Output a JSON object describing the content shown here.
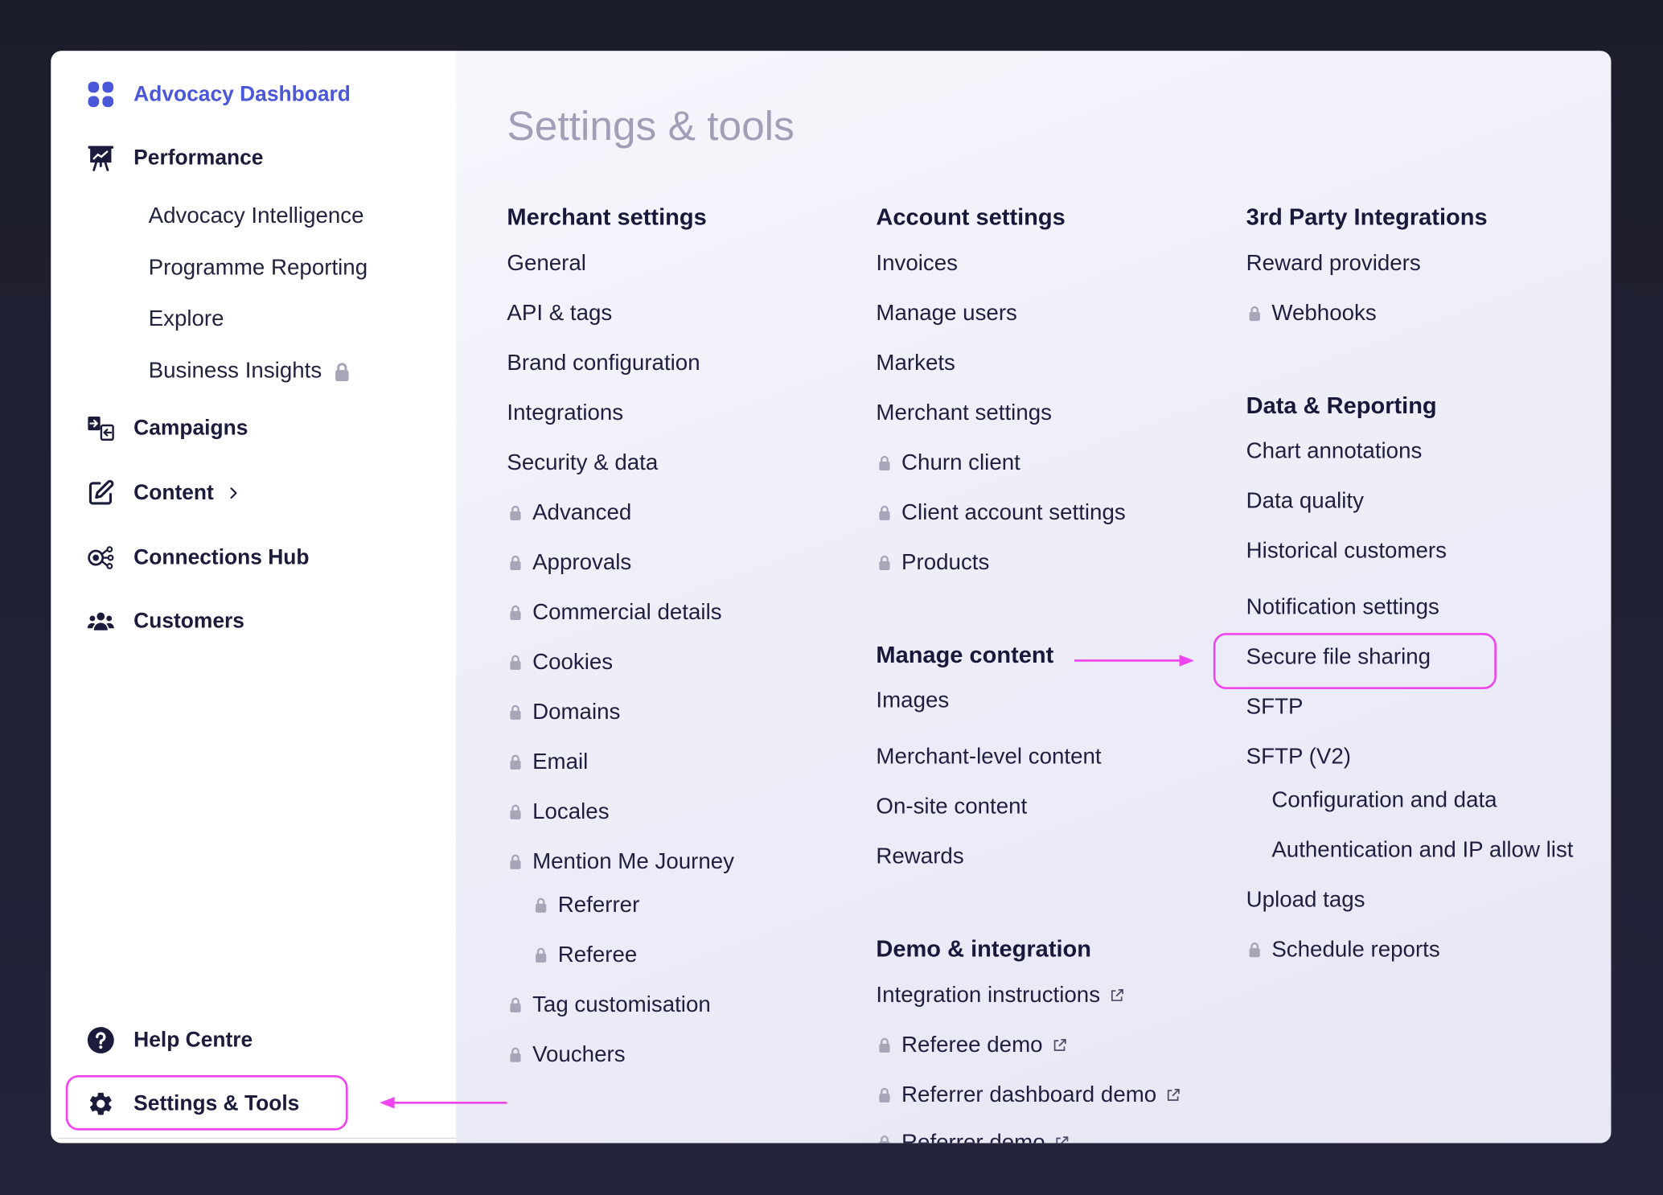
{
  "colors": {
    "page_background": "#1e1f2f",
    "accent": "#4b57d9",
    "text": "#1c1d3c",
    "title": "#9f9fb7",
    "lock": "#a6a6b8",
    "annotation": "#ee45ee"
  },
  "sidebar": {
    "dashboard": {
      "label": "Advocacy Dashboard",
      "icon": "dashboard-grid-icon",
      "active": true
    },
    "performance": {
      "label": "Performance",
      "icon": "presentation-chart-icon",
      "children": [
        {
          "label": "Advocacy Intelligence"
        },
        {
          "label": "Programme Reporting"
        },
        {
          "label": "Explore"
        },
        {
          "label": "Business Insights",
          "locked": true
        }
      ]
    },
    "campaigns": {
      "label": "Campaigns",
      "icon": "campaigns-swap-icon"
    },
    "content": {
      "label": "Content",
      "icon": "edit-icon",
      "expandable": true
    },
    "connections_hub": {
      "label": "Connections Hub",
      "icon": "connections-hub-icon"
    },
    "customers": {
      "label": "Customers",
      "icon": "users-group-icon"
    },
    "help_centre": {
      "label": "Help Centre",
      "icon": "help-circle-icon"
    },
    "settings_tools": {
      "label": "Settings & Tools",
      "icon": "gear-icon",
      "highlighted": true
    }
  },
  "main": {
    "title": "Settings & tools",
    "merchant_settings": {
      "heading": "Merchant settings",
      "items": [
        {
          "label": "General"
        },
        {
          "label": "API & tags"
        },
        {
          "label": "Brand configuration"
        },
        {
          "label": "Integrations"
        },
        {
          "label": "Security & data"
        },
        {
          "label": "Advanced",
          "locked": true
        },
        {
          "label": "Approvals",
          "locked": true
        },
        {
          "label": "Commercial details",
          "locked": true
        },
        {
          "label": "Cookies",
          "locked": true
        },
        {
          "label": "Domains",
          "locked": true
        },
        {
          "label": "Email",
          "locked": true
        },
        {
          "label": "Locales",
          "locked": true
        },
        {
          "label": "Mention Me Journey",
          "locked": true,
          "children": [
            {
              "label": "Referrer",
              "locked": true
            },
            {
              "label": "Referee",
              "locked": true
            }
          ]
        },
        {
          "label": "Tag customisation",
          "locked": true
        },
        {
          "label": "Vouchers",
          "locked": true
        }
      ]
    },
    "account_settings": {
      "heading": "Account settings",
      "items": [
        {
          "label": "Invoices"
        },
        {
          "label": "Manage users"
        },
        {
          "label": "Markets"
        },
        {
          "label": "Merchant settings"
        },
        {
          "label": "Churn client",
          "locked": true
        },
        {
          "label": "Client account settings",
          "locked": true
        },
        {
          "label": "Products",
          "locked": true
        }
      ]
    },
    "manage_content": {
      "heading": "Manage content",
      "items": [
        {
          "label": "Images"
        },
        {
          "label": "Merchant-level content"
        },
        {
          "label": "On-site content"
        },
        {
          "label": "Rewards"
        }
      ]
    },
    "demo_integration": {
      "heading": "Demo & integration",
      "items": [
        {
          "label": "Integration instructions",
          "external": true
        },
        {
          "label": "Referee demo",
          "locked": true,
          "external": true
        },
        {
          "label": "Referrer dashboard demo",
          "locked": true,
          "external": true
        },
        {
          "label": "Referrer demo",
          "locked": true,
          "external": true
        }
      ]
    },
    "third_party_integrations": {
      "heading": "3rd Party Integrations",
      "items": [
        {
          "label": "Reward providers"
        },
        {
          "label": "Webhooks",
          "locked": true
        }
      ]
    },
    "data_reporting": {
      "heading": "Data & Reporting",
      "items": [
        {
          "label": "Chart annotations"
        },
        {
          "label": "Data quality"
        },
        {
          "label": "Historical customers"
        },
        {
          "label": "Notification settings"
        },
        {
          "label": "Secure file sharing",
          "highlighted": true
        },
        {
          "label": "SFTP"
        },
        {
          "label": "SFTP (V2)",
          "children": [
            {
              "label": "Configuration and data"
            },
            {
              "label": "Authentication and IP allow list"
            }
          ]
        },
        {
          "label": "Upload tags"
        },
        {
          "label": "Schedule reports",
          "locked": true
        }
      ]
    }
  }
}
